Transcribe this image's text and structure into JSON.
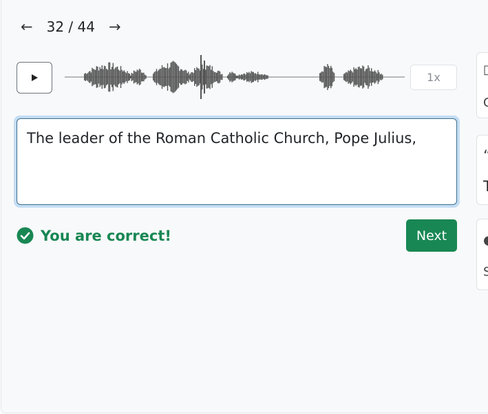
{
  "nav": {
    "counter": "32 / 44",
    "prev_icon": "arrow-left-icon",
    "next_icon": "arrow-right-icon"
  },
  "player": {
    "play_icon": "play-icon",
    "speed_label": "1x"
  },
  "answer": {
    "text": "The leader of the Roman Catholic Church, Pope Julius,"
  },
  "feedback": {
    "icon": "check-circle-icon",
    "message": "You are correct!"
  },
  "actions": {
    "next_label": "Next"
  },
  "side_cards": [
    {
      "icon": "edit-square-icon",
      "glyph_top": "□",
      "glyph_bottom": "C"
    },
    {
      "icon": "quote-icon",
      "glyph_top": "“",
      "glyph_bottom": "T"
    },
    {
      "icon": "speech-bubble-icon",
      "glyph_top": "●",
      "glyph_bottom": "S"
    }
  ],
  "colors": {
    "success": "#198754",
    "focus_ring": "#c4ddf3",
    "panel_bg": "#f8f9fa"
  }
}
